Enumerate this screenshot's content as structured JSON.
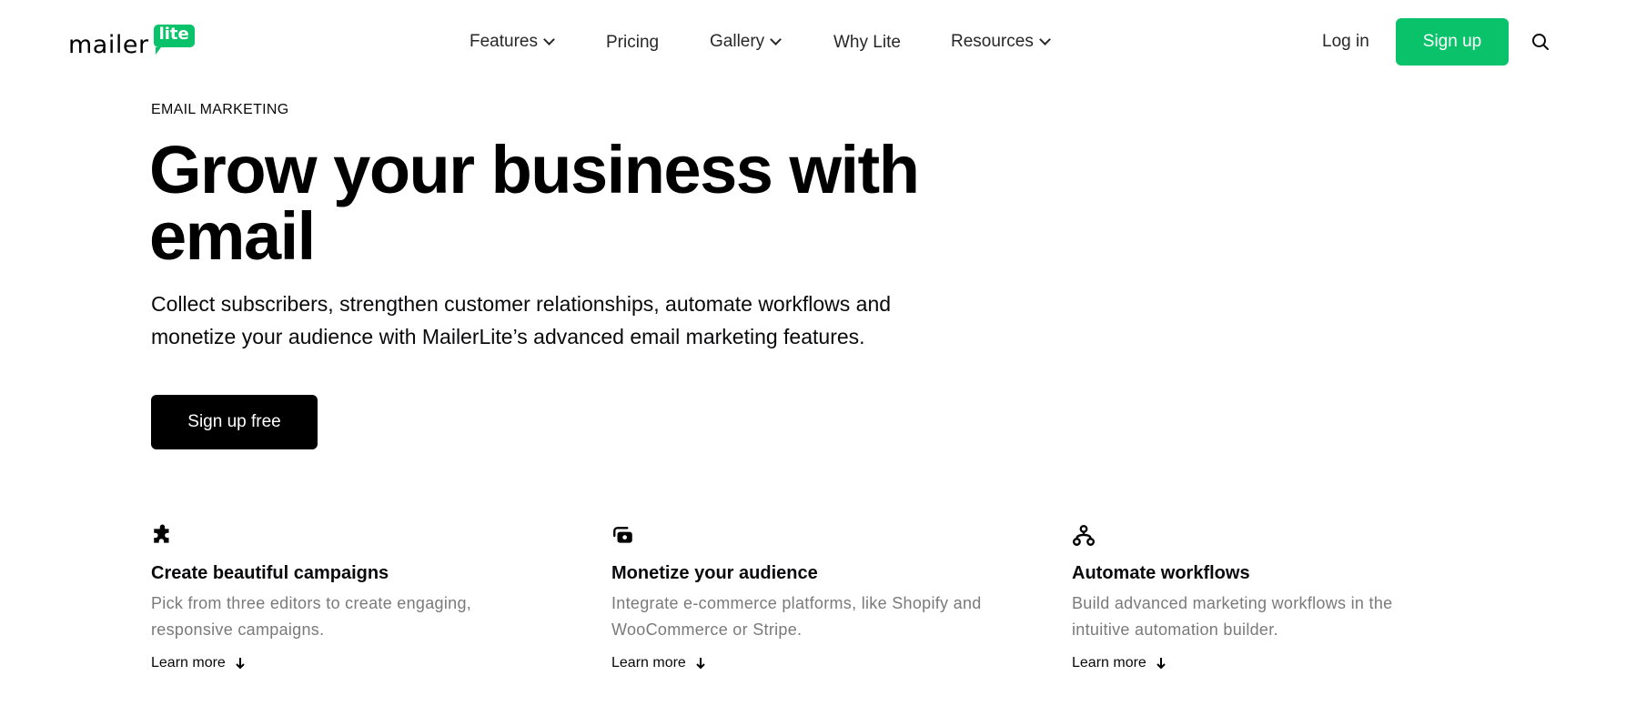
{
  "brand": {
    "word": "mailer",
    "badge": "lite",
    "accent": "#09c269"
  },
  "nav": {
    "items": [
      {
        "label": "Features",
        "dropdown": true
      },
      {
        "label": "Pricing",
        "dropdown": false
      },
      {
        "label": "Gallery",
        "dropdown": true
      },
      {
        "label": "Why Lite",
        "dropdown": false
      },
      {
        "label": "Resources",
        "dropdown": true
      }
    ],
    "login": "Log in",
    "signup": "Sign up",
    "search_icon": "search-icon"
  },
  "hero": {
    "eyebrow": "EMAIL MARKETING",
    "headline": "Grow your business with email",
    "lead": "Collect subscribers, strengthen customer relationships, automate workflows and monetize your audience with MailerLite’s advanced email marketing features.",
    "cta": "Sign up free"
  },
  "features": [
    {
      "icon": "puzzle-icon",
      "title": "Create beautiful campaigns",
      "desc": "Pick from three editors to create engaging, responsive campaigns.",
      "link": "Learn more"
    },
    {
      "icon": "money-icon",
      "title": "Monetize your audience",
      "desc": "Integrate e-commerce platforms, like Shopify and WooCommerce or Stripe.",
      "link": "Learn more"
    },
    {
      "icon": "workflow-icon",
      "title": "Automate workflows",
      "desc": "Build advanced marketing workflows in the intuitive automation builder.",
      "link": "Learn more"
    }
  ]
}
